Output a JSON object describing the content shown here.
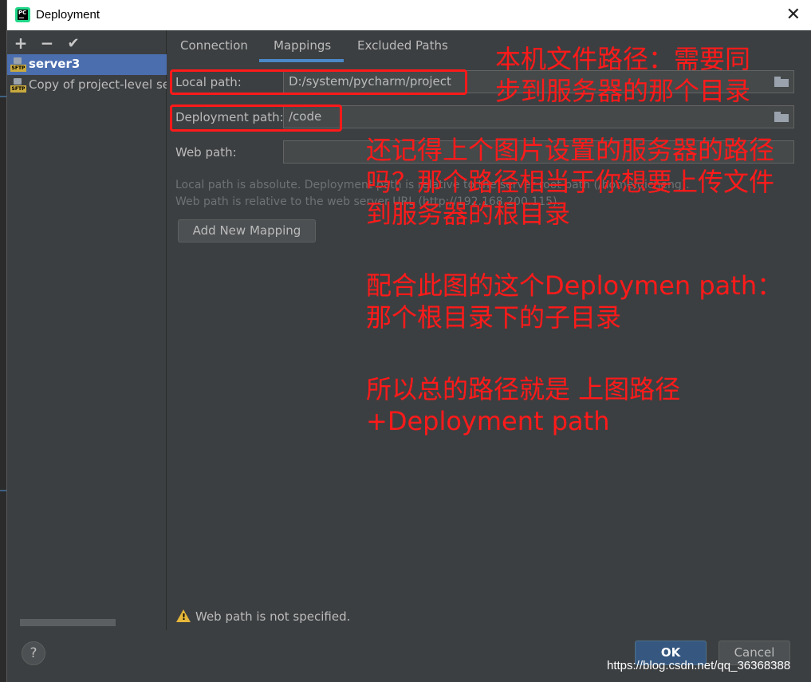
{
  "window": {
    "title": "Deployment",
    "app_icon_label": "PC"
  },
  "sidebar": {
    "toolbar": [
      {
        "name": "add-server-button",
        "icon": "plus-icon",
        "glyph": "+"
      },
      {
        "name": "remove-server-button",
        "icon": "minus-icon",
        "glyph": "−"
      },
      {
        "name": "set-default-button",
        "icon": "check-icon",
        "glyph": "✔"
      }
    ],
    "items": [
      {
        "label": "server3",
        "badge": "SFTP",
        "selected": true
      },
      {
        "label": "Copy of project-level se",
        "badge": "SFTP",
        "selected": false
      }
    ]
  },
  "tabs": [
    "Connection",
    "Mappings",
    "Excluded Paths"
  ],
  "active_tab": "Mappings",
  "form": {
    "local_path_label": "Local path:",
    "local_path_value": "D:/system/pycharm/project",
    "deployment_path_label": "Deployment path:",
    "deployment_path_value": "/code",
    "web_path_label": "Web path:",
    "web_path_value": "",
    "hint_line1": "Local path is absolute. Deployment path is relative to the server root path (/home/qicheng).",
    "hint_line2": "Web path is relative to the web server URL (http://192.168.200.115).",
    "add_mapping_label": "Add New Mapping"
  },
  "warning": {
    "text": "Web path is not specified."
  },
  "buttons": {
    "help": "?",
    "ok": "OK",
    "cancel": "Cancel"
  },
  "watermark": "https://blog.csdn.net/qq_36368388",
  "annotations": {
    "note1_line1": "本机文件路径：需要同",
    "note1_line2": "步到服务器的那个目录",
    "note2_line1": "还记得上个图片设置的服务器的路径",
    "note2_line2": "吗？那个路径相当于你想要上传文件",
    "note2_line3": "到服务器的根目录",
    "note3_line1": "配合此图的这个Deploymen path：",
    "note3_line2": "那个根目录下的子目录",
    "note4_line1": "所以总的路径就是 上图路径",
    "note4_line2": "+Deployment path",
    "color": "#ff1a1a"
  }
}
